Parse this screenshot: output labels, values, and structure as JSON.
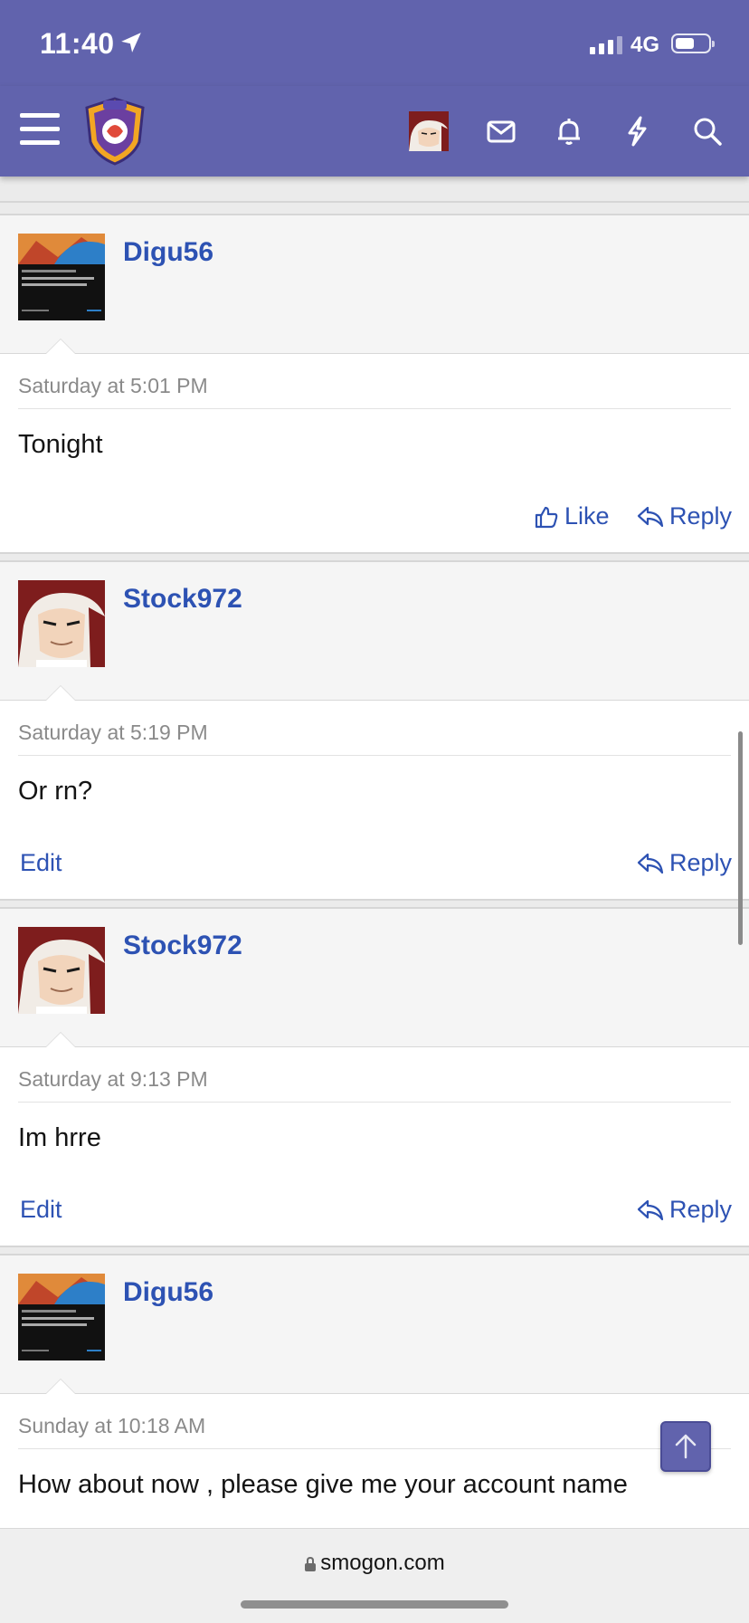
{
  "status_bar": {
    "time": "11:40",
    "network": "4G",
    "battery_level": 0.5
  },
  "header": {
    "icons": [
      "menu-icon",
      "site-logo",
      "user-avatar",
      "mail-icon",
      "bell-icon",
      "bolt-icon",
      "search-icon"
    ]
  },
  "posts": [
    {
      "username": "Digu56",
      "date": "Saturday at 5:01 PM",
      "message": "Tonight",
      "like_label": "Like",
      "reply_label": "Reply"
    },
    {
      "username": "Stock972",
      "date": "Saturday at 5:19 PM",
      "message": "Or rn?",
      "edit_label": "Edit",
      "reply_label": "Reply"
    },
    {
      "username": "Stock972",
      "date": "Saturday at 9:13 PM",
      "message": "Im hrre",
      "edit_label": "Edit",
      "reply_label": "Reply"
    },
    {
      "username": "Digu56",
      "date": "Sunday at 10:18 AM",
      "message": "How about now , please give me your account name"
    }
  ],
  "browser": {
    "url": "smogon.com"
  },
  "colors": {
    "header": "#6163ad",
    "link": "#2d52b3"
  }
}
